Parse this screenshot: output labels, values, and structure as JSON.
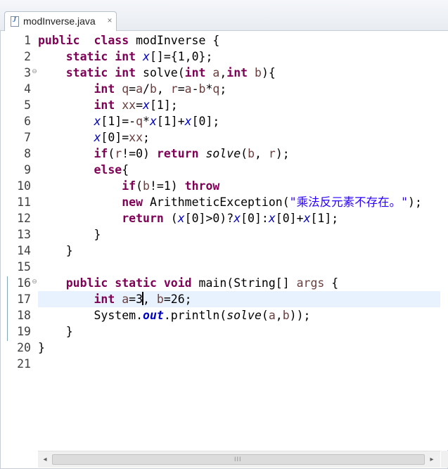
{
  "tab": {
    "label": "modInverse.java",
    "close_glyph": "×",
    "file_icon_glyph": "J"
  },
  "editor": {
    "current_line": 17,
    "lines": [
      {
        "n": "1",
        "fold": "",
        "tokens": [
          [
            "kw",
            "public"
          ],
          [
            "",
            "  "
          ],
          [
            "kw",
            "class"
          ],
          [
            "",
            " modInverse {"
          ]
        ]
      },
      {
        "n": "2",
        "fold": "",
        "tokens": [
          [
            "",
            "    "
          ],
          [
            "kw",
            "static"
          ],
          [
            "",
            " "
          ],
          [
            "kw",
            "int"
          ],
          [
            "",
            " "
          ],
          [
            "fld",
            "x"
          ],
          [
            "",
            "[]={1,0};"
          ]
        ]
      },
      {
        "n": "3",
        "fold": "⊖",
        "tokens": [
          [
            "",
            "    "
          ],
          [
            "kw",
            "static"
          ],
          [
            "",
            " "
          ],
          [
            "kw",
            "int"
          ],
          [
            "",
            " solve("
          ],
          [
            "kw",
            "int"
          ],
          [
            "",
            " "
          ],
          [
            "var",
            "a"
          ],
          [
            "",
            ","
          ],
          [
            "kw",
            "int"
          ],
          [
            "",
            " "
          ],
          [
            "var",
            "b"
          ],
          [
            "",
            "){"
          ]
        ]
      },
      {
        "n": "4",
        "fold": "",
        "tokens": [
          [
            "",
            "        "
          ],
          [
            "kw",
            "int"
          ],
          [
            "",
            " "
          ],
          [
            "var",
            "q"
          ],
          [
            "",
            "="
          ],
          [
            "var",
            "a"
          ],
          [
            "",
            "/"
          ],
          [
            "var",
            "b"
          ],
          [
            "",
            ", "
          ],
          [
            "var",
            "r"
          ],
          [
            "",
            "="
          ],
          [
            "var",
            "a"
          ],
          [
            "",
            "-"
          ],
          [
            "var",
            "b"
          ],
          [
            "",
            "*"
          ],
          [
            "var",
            "q"
          ],
          [
            "",
            ";"
          ]
        ]
      },
      {
        "n": "5",
        "fold": "",
        "tokens": [
          [
            "",
            "        "
          ],
          [
            "kw",
            "int"
          ],
          [
            "",
            " "
          ],
          [
            "var",
            "xx"
          ],
          [
            "",
            "="
          ],
          [
            "fld",
            "x"
          ],
          [
            "",
            "[1];"
          ]
        ]
      },
      {
        "n": "6",
        "fold": "",
        "tokens": [
          [
            "",
            "        "
          ],
          [
            "fld",
            "x"
          ],
          [
            "",
            "[1]=-"
          ],
          [
            "var",
            "q"
          ],
          [
            "",
            "*"
          ],
          [
            "fld",
            "x"
          ],
          [
            "",
            "[1]+"
          ],
          [
            "fld",
            "x"
          ],
          [
            "",
            "[0];"
          ]
        ]
      },
      {
        "n": "7",
        "fold": "",
        "tokens": [
          [
            "",
            "        "
          ],
          [
            "fld",
            "x"
          ],
          [
            "",
            "[0]="
          ],
          [
            "var",
            "xx"
          ],
          [
            "",
            ";"
          ]
        ]
      },
      {
        "n": "8",
        "fold": "",
        "tokens": [
          [
            "",
            "        "
          ],
          [
            "kw",
            "if"
          ],
          [
            "",
            "("
          ],
          [
            "var",
            "r"
          ],
          [
            "",
            "!=0) "
          ],
          [
            "kw",
            "return"
          ],
          [
            "",
            " "
          ],
          [
            "call",
            "solve"
          ],
          [
            "",
            "("
          ],
          [
            "var",
            "b"
          ],
          [
            "",
            ", "
          ],
          [
            "var",
            "r"
          ],
          [
            "",
            ");"
          ]
        ]
      },
      {
        "n": "9",
        "fold": "",
        "tokens": [
          [
            "",
            "        "
          ],
          [
            "kw",
            "else"
          ],
          [
            "",
            "{"
          ]
        ]
      },
      {
        "n": "10",
        "fold": "",
        "tokens": [
          [
            "",
            "            "
          ],
          [
            "kw",
            "if"
          ],
          [
            "",
            "("
          ],
          [
            "var",
            "b"
          ],
          [
            "",
            "!=1) "
          ],
          [
            "kw",
            "throw"
          ]
        ]
      },
      {
        "n": "11",
        "fold": "",
        "tokens": [
          [
            "",
            "            "
          ],
          [
            "kw",
            "new"
          ],
          [
            "",
            " ArithmeticException("
          ],
          [
            "str",
            "\"乘法反元素不存在。\""
          ],
          [
            "",
            ");"
          ]
        ]
      },
      {
        "n": "12",
        "fold": "",
        "tokens": [
          [
            "",
            "            "
          ],
          [
            "kw",
            "return"
          ],
          [
            "",
            " ("
          ],
          [
            "fld",
            "x"
          ],
          [
            "",
            "[0]>0)?"
          ],
          [
            "fld",
            "x"
          ],
          [
            "",
            "[0]:"
          ],
          [
            "fld",
            "x"
          ],
          [
            "",
            "[0]+"
          ],
          [
            "fld",
            "x"
          ],
          [
            "",
            "[1];"
          ]
        ]
      },
      {
        "n": "13",
        "fold": "",
        "tokens": [
          [
            "",
            "        }"
          ]
        ]
      },
      {
        "n": "14",
        "fold": "",
        "tokens": [
          [
            "",
            "    }"
          ]
        ]
      },
      {
        "n": "15",
        "fold": "",
        "tokens": [
          [
            "",
            ""
          ]
        ]
      },
      {
        "n": "16",
        "fold": "⊖",
        "tokens": [
          [
            "",
            "    "
          ],
          [
            "kw",
            "public"
          ],
          [
            "",
            " "
          ],
          [
            "kw",
            "static"
          ],
          [
            "",
            " "
          ],
          [
            "kw",
            "void"
          ],
          [
            "",
            " main(String[] "
          ],
          [
            "var",
            "args"
          ],
          [
            "",
            " {"
          ]
        ]
      },
      {
        "n": "17",
        "fold": "",
        "tokens": [
          [
            "",
            "        "
          ],
          [
            "kw",
            "int"
          ],
          [
            "",
            " "
          ],
          [
            "var",
            "a"
          ],
          [
            "",
            "=3"
          ],
          [
            "cursor",
            ""
          ],
          [
            "",
            ", "
          ],
          [
            "var",
            "b"
          ],
          [
            "",
            "=26;"
          ]
        ]
      },
      {
        "n": "18",
        "fold": "",
        "tokens": [
          [
            "",
            "        System."
          ],
          [
            "sfield",
            "out"
          ],
          [
            "",
            ".println("
          ],
          [
            "call",
            "solve"
          ],
          [
            "",
            "("
          ],
          [
            "var",
            "a"
          ],
          [
            "",
            ","
          ],
          [
            "var",
            "b"
          ],
          [
            "",
            "));"
          ]
        ]
      },
      {
        "n": "19",
        "fold": "",
        "tokens": [
          [
            "",
            "    }"
          ]
        ]
      },
      {
        "n": "20",
        "fold": "",
        "tokens": [
          [
            "",
            "}"
          ]
        ]
      },
      {
        "n": "21",
        "fold": "",
        "tokens": [
          [
            "",
            ""
          ]
        ]
      }
    ]
  },
  "hscroll": {
    "left_arrow": "◂",
    "right_arrow": "▸",
    "grip": "III"
  },
  "colors": {
    "keyword": "#7f0055",
    "field": "#0000c0",
    "string": "#2a00ff",
    "local_var": "#6a3e3e",
    "current_line": "#e8f2fe",
    "change_marker": "#7fa8b4"
  }
}
